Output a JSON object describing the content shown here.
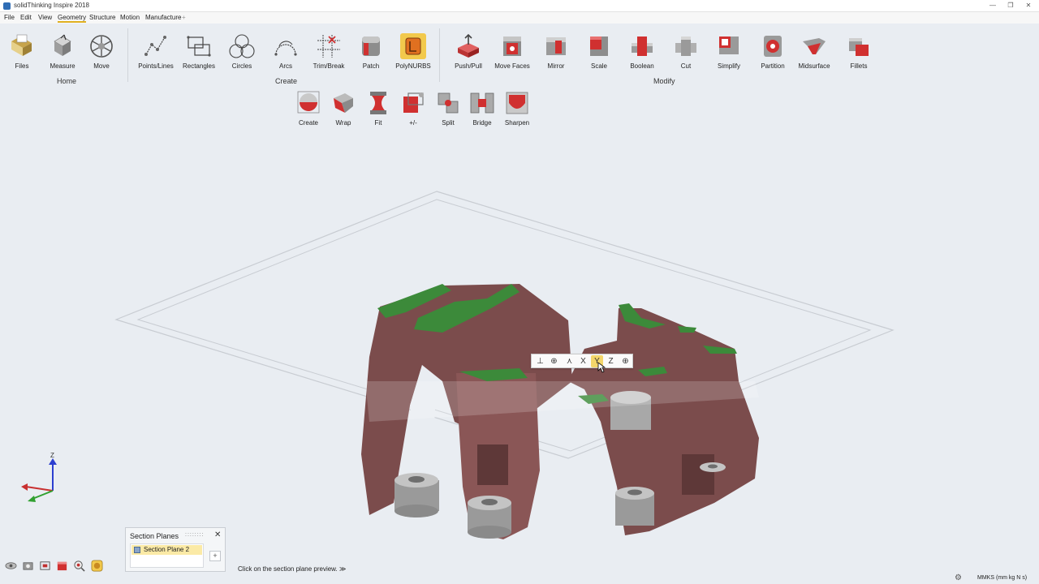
{
  "window": {
    "title": "solidThinking Inspire 2018",
    "controls": [
      "—",
      "❐",
      "✕"
    ]
  },
  "menubar": {
    "items": [
      "File",
      "Edit",
      "View",
      "Geometry",
      "Structure",
      "Motion",
      "Manufacture"
    ],
    "active": "Geometry",
    "add": "+"
  },
  "ribbon": {
    "home": {
      "label": "Home",
      "tools": [
        "Files",
        "Measure",
        "Move"
      ]
    },
    "create": {
      "label": "Create",
      "tools": [
        "Points/Lines",
        "Rectangles",
        "Circles",
        "Arcs",
        "Trim/Break",
        "Patch",
        "PolyNURBS"
      ]
    },
    "modify": {
      "label": "Modify",
      "tools": [
        "Push/Pull",
        "Move Faces",
        "Mirror",
        "Scale",
        "Boolean",
        "Cut",
        "Simplify",
        "Partition",
        "Midsurface",
        "Fillets"
      ]
    },
    "polynurbs_tools": [
      "Create",
      "Wrap",
      "Fit",
      "+/-",
      "Split",
      "Bridge",
      "Sharpen"
    ]
  },
  "minibar": {
    "x": "X",
    "y": "Y",
    "z": "Z",
    "selected": "Y"
  },
  "triad": {
    "z": "Z"
  },
  "section_panel": {
    "title": "Section Planes",
    "grip": "::::::::",
    "close": "✕",
    "item": "Section Plane 2",
    "add": "+"
  },
  "status": {
    "hint": "Click on the section plane preview.",
    "hint_chevron": "≫",
    "units": "MMKS (mm kg N s)",
    "gear": "⚙"
  },
  "colors": {
    "accent": "#e0b020",
    "part": "#7b4c4c",
    "design_face": "#3c8a3a",
    "nondesign": "#9a9a9a"
  }
}
